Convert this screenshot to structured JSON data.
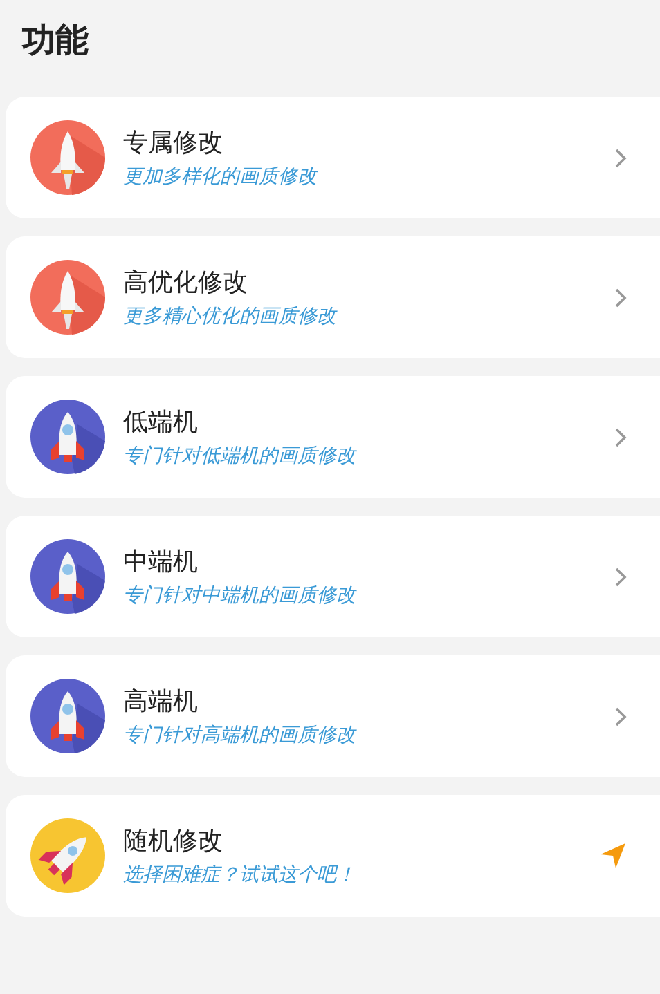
{
  "title": "功能",
  "items": [
    {
      "kind": "shuttle",
      "title": "专属修改",
      "subtitle": "更加多样化的画质修改"
    },
    {
      "kind": "shuttle",
      "title": "高优化修改",
      "subtitle": "更多精心优化的画质修改"
    },
    {
      "kind": "rocket",
      "title": "低端机",
      "subtitle": "专门针对低端机的画质修改"
    },
    {
      "kind": "rocket",
      "title": "中端机",
      "subtitle": "专门针对中端机的画质修改"
    },
    {
      "kind": "rocket",
      "title": "高端机",
      "subtitle": "专门针对高端机的画质修改"
    },
    {
      "kind": "random",
      "title": "随机修改",
      "subtitle": "选择困难症？试试这个吧！"
    }
  ]
}
